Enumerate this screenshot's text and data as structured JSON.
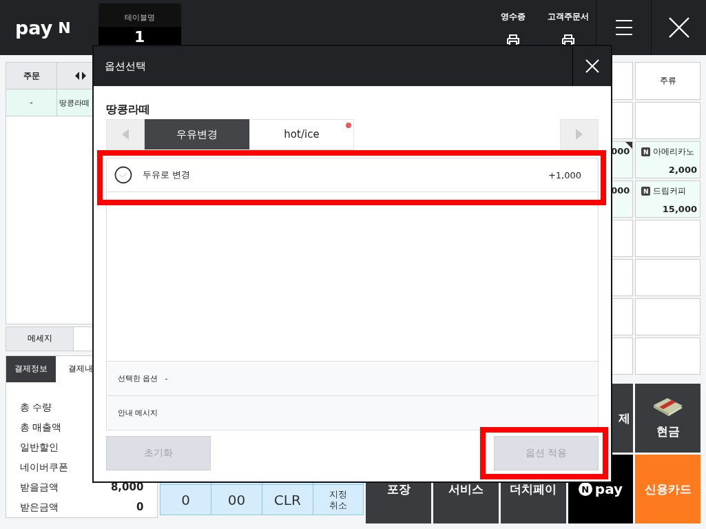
{
  "header": {
    "logo": "pay",
    "logo_badge": "N",
    "table_label": "테이블명",
    "table_value": "1",
    "actions": [
      {
        "label": "영수증"
      },
      {
        "label": "고객주문서"
      }
    ]
  },
  "order_table": {
    "columns": [
      "주문"
    ],
    "rows": [
      {
        "cells": [
          "-",
          "땅콩라떼"
        ],
        "selected": true
      }
    ]
  },
  "message_button": "메세지",
  "payment_tabs": [
    {
      "label": "결제정보",
      "selected": true
    },
    {
      "label": "결제내",
      "selected": false
    }
  ],
  "summary": [
    {
      "label": "총 수량"
    },
    {
      "label": "총 매출액"
    },
    {
      "label": "일반할인"
    },
    {
      "label": "네이버쿠폰"
    },
    {
      "label": "받을금액",
      "value": "8,000"
    },
    {
      "label": "받은금액",
      "value": "0"
    }
  ],
  "keypad": [
    "0",
    "00",
    "CLR",
    "지정\n취소"
  ],
  "category": "주류",
  "menu_items": [
    {
      "partial_price": "000",
      "marked": true,
      "badge": "N",
      "name": "아메리카노",
      "price": "2,000"
    },
    {
      "partial_price": "000",
      "marked": false,
      "badge": "N",
      "name": "드립커피",
      "price": "15,000"
    }
  ],
  "payment_buttons_top": [
    {
      "label": "제",
      "kind": "dark"
    },
    {
      "label": "현금",
      "kind": "cash"
    }
  ],
  "payment_buttons_bottom": [
    {
      "label": "포장",
      "kind": "dark"
    },
    {
      "label": "서비스",
      "kind": "dark"
    },
    {
      "label": "더치페이",
      "kind": "dark"
    },
    {
      "label": "pay",
      "badge": "N",
      "kind": "npay"
    },
    {
      "label": "신용카드",
      "kind": "orange"
    }
  ],
  "option_dialog": {
    "title": "옵션선택",
    "product": "땅콩라떼",
    "tabs": [
      {
        "label": "우유변경",
        "selected": true,
        "dot": false
      },
      {
        "label": "hot/ice",
        "selected": false,
        "dot": true
      }
    ],
    "options": [
      {
        "label": "두유로 변경",
        "price": "+1,000",
        "checked": false
      }
    ],
    "selected_option_label": "선택한 옵션",
    "selected_option_value": "-",
    "notice_label": "안내 메시지",
    "buttons": [
      {
        "label": "초기화",
        "disabled": true
      },
      {
        "label": "옵션 적용",
        "disabled": true
      }
    ]
  }
}
